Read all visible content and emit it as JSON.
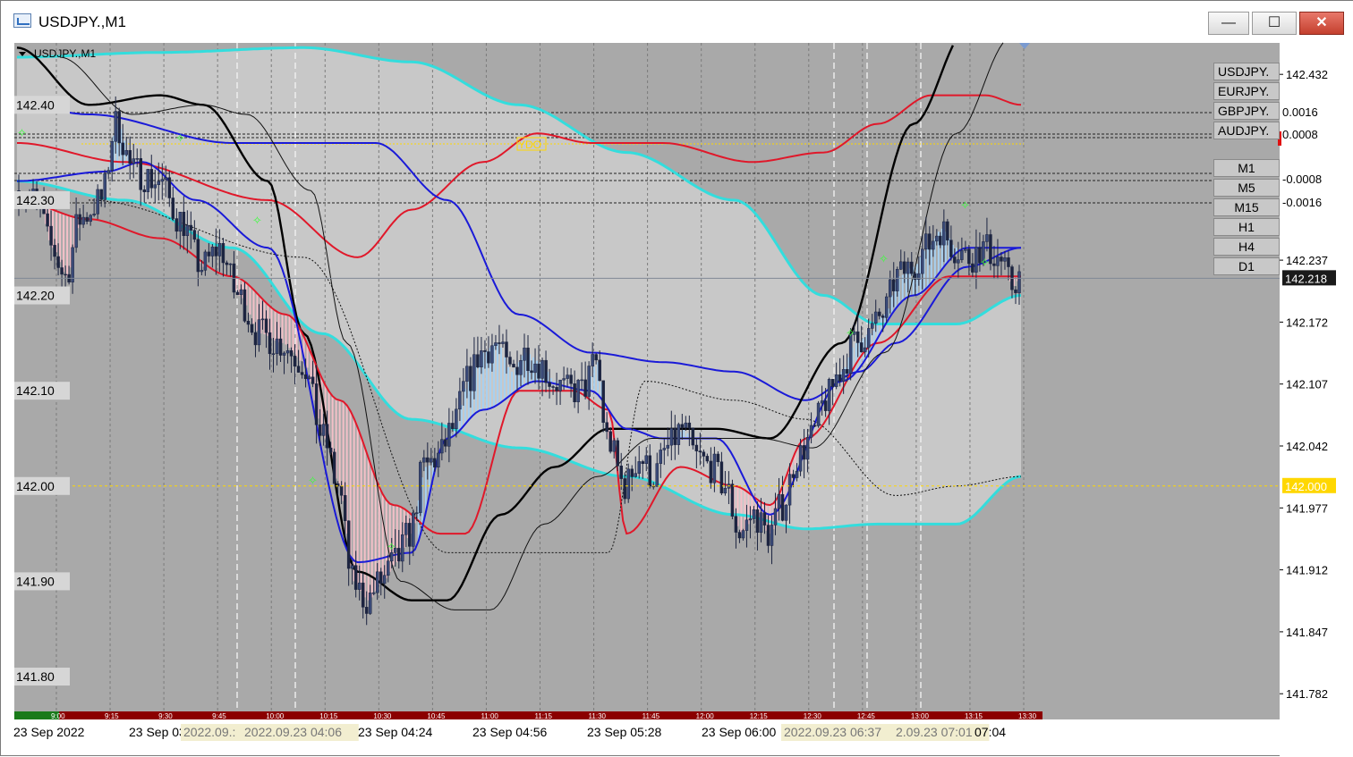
{
  "window": {
    "title": "USDJPY.,M1",
    "min_glyph": "—",
    "max_glyph": "☐",
    "close_glyph": "✕"
  },
  "chart_caption": "USDJPY.,M1",
  "symbols": [
    "USDJPY.",
    "EURJPY.",
    "GBPJPY.",
    "AUDJPY."
  ],
  "timeframes": [
    "M1",
    "M5",
    "M15",
    "H1",
    "H4",
    "D1"
  ],
  "panel_values": [
    "0.0016",
    "0.0008",
    "-0.0008",
    "-0.0016"
  ],
  "ydo_label": "YDO",
  "colors": {
    "bg": "#a9a9a9",
    "band_fill": "#c8c8c8",
    "bb": "#33dddd",
    "ma_red": "#e0182a",
    "ma_blue": "#1a1ad8",
    "ma_black": "#000000",
    "candle": "#1c2440",
    "fill_pink": "#f4c0c8",
    "fill_blue": "#a8d0f0",
    "current": "#1a1a1a",
    "round": "#ffd700",
    "maroon": "#8b0000",
    "green": "#1a7a1a"
  },
  "chart_data": {
    "type": "candlestick",
    "symbol": "USDJPY.",
    "timeframe": "M1",
    "ylim": [
      141.755,
      142.465
    ],
    "left_axis_ticks": [
      "142.40",
      "142.30",
      "142.20",
      "142.10",
      "142.00",
      "141.90",
      "141.80"
    ],
    "right_axis_ticks": [
      "142.432",
      "142.237",
      "142.172",
      "142.107",
      "142.042",
      "141.977",
      "141.912",
      "141.847",
      "141.782"
    ],
    "current_price": "142.218",
    "round_level": "142.000",
    "time_labels": [
      "23 Sep 2022",
      "23 Sep 03",
      "2022.09.:",
      "2022.09.23 04:06",
      "23 Sep 04:24",
      "23 Sep 04:56",
      "23 Sep 05:28",
      "23 Sep 06:00",
      "2022.09.23 06:37",
      "2.09.23 07:01",
      "07:04"
    ],
    "session_ticks": [
      "9:00",
      "9:15",
      "9:30",
      "9:45",
      "10:00",
      "10:15",
      "10:30",
      "10:45",
      "11:00",
      "11:15",
      "11:30",
      "11:45",
      "12:00",
      "12:15",
      "12:30",
      "12:45",
      "13:00",
      "13:15",
      "13:30"
    ],
    "series": [
      {
        "name": "",
        "role": "candles",
        "anchors": [
          [
            0,
            142.31
          ],
          [
            6,
            142.3
          ],
          [
            10,
            142.25
          ],
          [
            14,
            142.22
          ],
          [
            18,
            142.28
          ],
          [
            24,
            142.3
          ],
          [
            28,
            142.38
          ],
          [
            33,
            142.33
          ],
          [
            40,
            142.32
          ],
          [
            46,
            142.28
          ],
          [
            52,
            142.23
          ],
          [
            57,
            142.25
          ],
          [
            62,
            142.2
          ],
          [
            68,
            142.16
          ],
          [
            74,
            142.15
          ],
          [
            80,
            142.13
          ],
          [
            86,
            142.05
          ],
          [
            90,
            142.0
          ],
          [
            94,
            141.9
          ],
          [
            98,
            141.88
          ],
          [
            102,
            141.9
          ],
          [
            106,
            141.92
          ],
          [
            110,
            141.95
          ],
          [
            114,
            142.02
          ],
          [
            118,
            142.03
          ],
          [
            122,
            142.06
          ],
          [
            126,
            142.11
          ],
          [
            130,
            142.14
          ],
          [
            134,
            142.15
          ],
          [
            138,
            142.12
          ],
          [
            142,
            142.14
          ],
          [
            146,
            142.13
          ],
          [
            150,
            142.11
          ],
          [
            154,
            142.1
          ],
          [
            158,
            142.1
          ],
          [
            162,
            142.13
          ],
          [
            165,
            142.05
          ],
          [
            170,
            142.0
          ],
          [
            174,
            142.03
          ],
          [
            178,
            142.01
          ],
          [
            182,
            142.04
          ],
          [
            186,
            142.06
          ],
          [
            190,
            142.03
          ],
          [
            194,
            142.02
          ],
          [
            198,
            142.0
          ],
          [
            202,
            141.95
          ],
          [
            206,
            141.97
          ],
          [
            210,
            141.95
          ],
          [
            214,
            141.98
          ],
          [
            218,
            142.03
          ],
          [
            222,
            142.05
          ],
          [
            226,
            142.09
          ],
          [
            230,
            142.12
          ],
          [
            234,
            142.15
          ],
          [
            238,
            142.16
          ],
          [
            242,
            142.18
          ],
          [
            246,
            142.22
          ],
          [
            250,
            142.23
          ],
          [
            254,
            142.25
          ],
          [
            258,
            142.27
          ],
          [
            262,
            142.25
          ],
          [
            266,
            142.24
          ],
          [
            270,
            142.25
          ],
          [
            274,
            142.24
          ],
          [
            278,
            142.21
          ],
          [
            280,
            142.22
          ]
        ]
      },
      {
        "name": "",
        "role": "bb_upper",
        "anchors": [
          [
            0,
            142.45
          ],
          [
            40,
            142.455
          ],
          [
            80,
            142.46
          ],
          [
            110,
            142.445
          ],
          [
            140,
            142.4
          ],
          [
            170,
            142.35
          ],
          [
            200,
            142.3
          ],
          [
            225,
            142.2
          ],
          [
            240,
            142.17
          ],
          [
            262,
            142.17
          ],
          [
            280,
            142.2
          ]
        ]
      },
      {
        "name": "",
        "role": "bb_lower",
        "anchors": [
          [
            0,
            142.32
          ],
          [
            30,
            142.3
          ],
          [
            60,
            142.25
          ],
          [
            85,
            142.16
          ],
          [
            110,
            142.07
          ],
          [
            140,
            142.04
          ],
          [
            170,
            142.01
          ],
          [
            200,
            141.97
          ],
          [
            220,
            141.955
          ],
          [
            240,
            141.96
          ],
          [
            262,
            141.96
          ],
          [
            280,
            142.01
          ]
        ]
      },
      {
        "name": "",
        "role": "ma_red_long",
        "anchors": [
          [
            0,
            142.36
          ],
          [
            30,
            142.34
          ],
          [
            70,
            142.3
          ],
          [
            95,
            142.24
          ],
          [
            110,
            142.29
          ],
          [
            130,
            142.34
          ],
          [
            145,
            142.37
          ],
          [
            160,
            142.36
          ],
          [
            180,
            142.36
          ],
          [
            205,
            142.34
          ],
          [
            225,
            142.35
          ],
          [
            240,
            142.38
          ],
          [
            255,
            142.41
          ],
          [
            270,
            142.41
          ],
          [
            280,
            142.4
          ]
        ]
      },
      {
        "name": "",
        "role": "ma_blue_long",
        "anchors": [
          [
            0,
            142.4
          ],
          [
            20,
            142.39
          ],
          [
            60,
            142.36
          ],
          [
            100,
            142.36
          ],
          [
            120,
            142.3
          ],
          [
            140,
            142.18
          ],
          [
            160,
            142.14
          ],
          [
            180,
            142.13
          ],
          [
            200,
            142.12
          ],
          [
            220,
            142.09
          ],
          [
            235,
            142.12
          ],
          [
            245,
            142.15
          ],
          [
            265,
            142.23
          ],
          [
            280,
            142.25
          ]
        ]
      },
      {
        "name": "",
        "role": "ma_black",
        "anchors": [
          [
            0,
            142.46
          ],
          [
            20,
            142.4
          ],
          [
            40,
            142.41
          ],
          [
            52,
            142.4
          ],
          [
            70,
            142.32
          ],
          [
            80,
            142.16
          ],
          [
            95,
            141.91
          ],
          [
            110,
            141.88
          ],
          [
            120,
            141.88
          ],
          [
            135,
            141.97
          ],
          [
            150,
            142.02
          ],
          [
            165,
            142.06
          ],
          [
            185,
            142.06
          ],
          [
            195,
            142.06
          ],
          [
            210,
            142.05
          ],
          [
            230,
            142.15
          ],
          [
            250,
            142.38
          ],
          [
            265,
            142.48
          ]
        ]
      },
      {
        "name": "",
        "role": "ma_red_fast",
        "anchors": [
          [
            0,
            142.3
          ],
          [
            20,
            142.28
          ],
          [
            40,
            142.26
          ],
          [
            60,
            142.22
          ],
          [
            75,
            142.18
          ],
          [
            90,
            142.09
          ],
          [
            105,
            141.98
          ],
          [
            118,
            141.95
          ],
          [
            125,
            141.95
          ],
          [
            140,
            142.1
          ],
          [
            155,
            142.1
          ],
          [
            165,
            142.08
          ],
          [
            170,
            141.95
          ],
          [
            185,
            142.02
          ],
          [
            200,
            142.0
          ],
          [
            210,
            141.98
          ],
          [
            220,
            142.05
          ],
          [
            240,
            142.15
          ],
          [
            260,
            142.22
          ],
          [
            280,
            142.22
          ]
        ]
      },
      {
        "name": "",
        "role": "ma_blue_fast",
        "anchors": [
          [
            0,
            142.32
          ],
          [
            25,
            142.33
          ],
          [
            35,
            142.34
          ],
          [
            50,
            142.3
          ],
          [
            70,
            142.25
          ],
          [
            95,
            141.92
          ],
          [
            110,
            141.93
          ],
          [
            120,
            142.05
          ],
          [
            130,
            142.08
          ],
          [
            145,
            142.11
          ],
          [
            160,
            142.1
          ],
          [
            170,
            142.06
          ],
          [
            180,
            142.05
          ],
          [
            195,
            142.05
          ],
          [
            210,
            141.97
          ],
          [
            230,
            142.11
          ],
          [
            250,
            142.2
          ],
          [
            265,
            142.25
          ],
          [
            280,
            142.25
          ]
        ]
      }
    ]
  }
}
